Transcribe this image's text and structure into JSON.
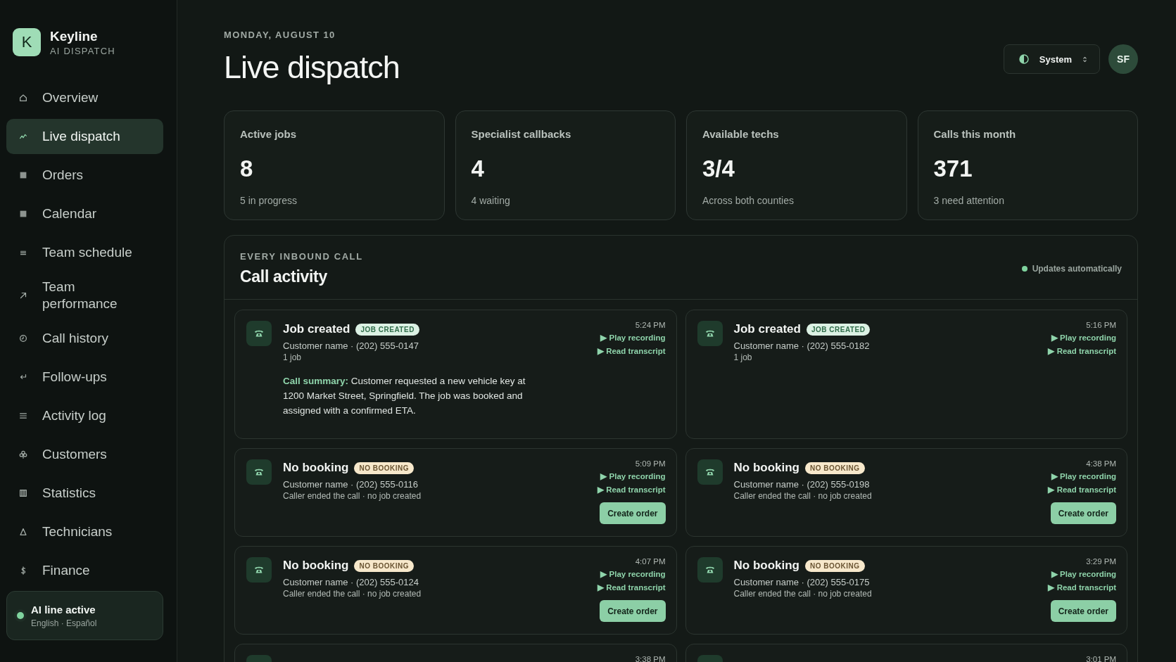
{
  "brand": {
    "logo_letter": "K",
    "name": "Keyline",
    "tagline": "AI DISPATCH"
  },
  "sidebar": {
    "items": [
      {
        "label": "Overview",
        "selected": false
      },
      {
        "label": "Live dispatch",
        "selected": true
      },
      {
        "label": "Orders",
        "selected": false
      },
      {
        "label": "Calendar",
        "selected": false
      },
      {
        "label": "Team schedule",
        "selected": false
      },
      {
        "label": "Team performance",
        "selected": false
      },
      {
        "label": "Call history",
        "selected": false
      },
      {
        "label": "Follow-ups",
        "selected": false
      },
      {
        "label": "Activity log",
        "selected": false
      },
      {
        "label": "Customers",
        "selected": false
      },
      {
        "label": "Statistics",
        "selected": false
      },
      {
        "label": "Technicians",
        "selected": false
      },
      {
        "label": "Finance",
        "selected": false
      }
    ],
    "status": {
      "title": "AI line active",
      "languages": "English · Español",
      "on": true
    }
  },
  "header": {
    "date": "MONDAY, AUGUST 10",
    "title": "Live dispatch",
    "theme": "System",
    "avatar": "SF"
  },
  "stats": [
    {
      "label": "Active jobs",
      "value": "8",
      "note": "5 in progress"
    },
    {
      "label": "Specialist callbacks",
      "value": "4",
      "note": "4 waiting"
    },
    {
      "label": "Available techs",
      "value": "3/4",
      "note": "Across both counties"
    },
    {
      "label": "Calls this month",
      "value": "371",
      "note": "3 need attention"
    }
  ],
  "activity": {
    "eyebrow": "EVERY INBOUND CALL",
    "title": "Call activity",
    "live_note": "Updates automatically",
    "calls": [
      {
        "kind": "job",
        "title": "Job created",
        "badge": "JOB CREATED",
        "caller": "Customer name · (202) 555-0147",
        "detail": "1 job",
        "summary": "**Call summary:** Customer requested a new vehicle key at 1200 Market Street, Springfield. The job was booked and assigned with a confirmed ETA.",
        "time": "5:24 PM",
        "actions": [
          "▶ Play recording",
          "▶ Read transcript"
        ]
      },
      {
        "kind": "job",
        "title": "Job created",
        "badge": "JOB CREATED",
        "caller": "Customer name · (202) 555-0182",
        "detail": "1 job",
        "time": "5:16 PM",
        "actions": [
          "▶ Play recording",
          "▶ Read transcript"
        ]
      },
      {
        "kind": "missed",
        "title": "No booking",
        "badge": "NO BOOKING",
        "caller": "Customer name · (202) 555-0116",
        "detail": "Caller ended the call · no job created",
        "time": "5:09 PM",
        "actions": [
          "▶ Play recording",
          "▶ Read transcript"
        ],
        "button": "Create order"
      },
      {
        "kind": "missed",
        "title": "No booking",
        "badge": "NO BOOKING",
        "caller": "Customer name · (202) 555-0198",
        "detail": "Caller ended the call · no job created",
        "time": "4:38 PM",
        "actions": [
          "▶ Play recording",
          "▶ Read transcript"
        ],
        "button": "Create order"
      },
      {
        "kind": "missed",
        "title": "No booking",
        "badge": "NO BOOKING",
        "caller": "Customer name · (202) 555-0124",
        "detail": "Caller ended the call · no job created",
        "time": "4:07 PM",
        "actions": [
          "▶ Play recording",
          "▶ Read transcript"
        ],
        "button": "Create order"
      },
      {
        "kind": "missed",
        "title": "No booking",
        "badge": "NO BOOKING",
        "caller": "Customer name · (202) 555-0175",
        "detail": "Caller ended the call · no job created",
        "time": "3:29 PM",
        "actions": [
          "▶ Play recording",
          "▶ Read transcript"
        ],
        "button": "Create order"
      },
      {
        "time": "3:38 PM"
      },
      {
        "time": "3:01 PM"
      }
    ]
  }
}
